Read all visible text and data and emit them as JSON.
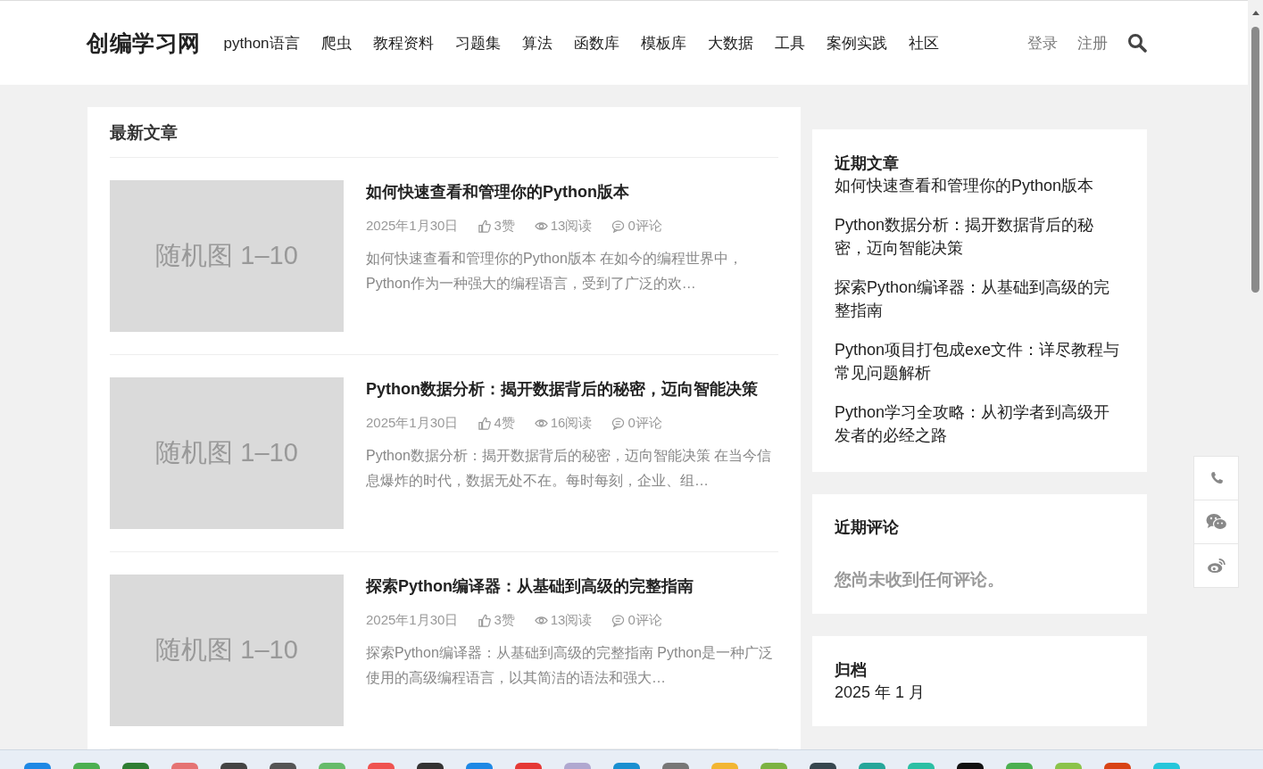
{
  "site": {
    "logo": "创编学习网",
    "nav": [
      "python语言",
      "爬虫",
      "教程资料",
      "习题集",
      "算法",
      "函数库",
      "模板库",
      "大数据",
      "工具",
      "案例实践",
      "社区"
    ],
    "auth": [
      "登录",
      "注册"
    ]
  },
  "main": {
    "title": "最新文章",
    "articles": [
      {
        "thumb": "随机图 1–10",
        "title": "如何快速查看和管理你的Python版本",
        "date": "2025年1月30日",
        "likes": "3赞",
        "views": "13阅读",
        "comments": "0评论",
        "excerpt": "如何快速查看和管理你的Python版本 在如今的编程世界中，Python作为一种强大的编程语言，受到了广泛的欢…"
      },
      {
        "thumb": "随机图 1–10",
        "title": "Python数据分析：揭开数据背后的秘密，迈向智能决策",
        "date": "2025年1月30日",
        "likes": "4赞",
        "views": "16阅读",
        "comments": "0评论",
        "excerpt": "Python数据分析：揭开数据背后的秘密，迈向智能决策 在当今信息爆炸的时代，数据无处不在。每时每刻，企业、组…"
      },
      {
        "thumb": "随机图 1–10",
        "title": "探索Python编译器：从基础到高级的完整指南",
        "date": "2025年1月30日",
        "likes": "3赞",
        "views": "13阅读",
        "comments": "0评论",
        "excerpt": "探索Python编译器：从基础到高级的完整指南 Python是一种广泛使用的高级编程语言，以其简洁的语法和强大…"
      }
    ]
  },
  "sidebar": {
    "recent_posts": {
      "title": "近期文章",
      "items": [
        "如何快速查看和管理你的Python版本",
        "Python数据分析：揭开数据背后的秘密，迈向智能决策",
        "探索Python编译器：从基础到高级的完整指南",
        "Python项目打包成exe文件：详尽教程与常见问题解析",
        "Python学习全攻略：从初学者到高级开发者的必经之路"
      ]
    },
    "recent_comments": {
      "title": "近期评论",
      "empty": "您尚未收到任何评论。"
    },
    "archives": {
      "title": "归档",
      "items": [
        "2025 年 1 月"
      ]
    }
  }
}
